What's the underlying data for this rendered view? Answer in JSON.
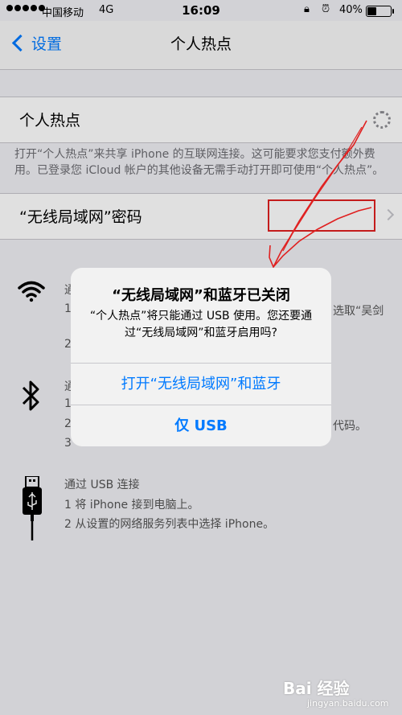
{
  "status_bar": {
    "carrier": "中国移动",
    "network": "4G",
    "time": "16:09",
    "battery_percent": "40%",
    "battery_level": 0.4
  },
  "nav": {
    "back_label": "设置",
    "title": "个人热点"
  },
  "hotspot_row": {
    "label": "个人热点"
  },
  "footnote": "打开“个人热点”来共享 iPhone 的互联网连接。这可能要求您支付额外费用。已登录您 iCloud 帐户的其他设备无需手动打开即可使用“个人热点”。",
  "password_row": {
    "label": "“无线局域网”密码"
  },
  "wifi_section": {
    "heading": "通",
    "line1": "1",
    "line1_tail": "选取“吴剑",
    "line2": "2"
  },
  "bt_section": {
    "heading": "通",
    "line1": "1",
    "line2": "2",
    "line2_tail": "代码。",
    "line3": "3"
  },
  "usb_section": {
    "heading": "通过 USB 连接",
    "step1": "1 将 iPhone 接到电脑上。",
    "step2": "2 从设置的网络服务列表中选择 iPhone。"
  },
  "alert": {
    "title": "“无线局域网”和蓝牙已关闭",
    "message": "“个人热点”将只能通过 USB 使用。您还要通过“无线局域网”和蓝牙启用吗?",
    "button_primary": "打开“无线局域网”和蓝牙",
    "button_usb": "仅 USB"
  },
  "watermark": {
    "brand": "Bai 经验",
    "url": "jingyan.baidu.com"
  },
  "colors": {
    "accent": "#007aff",
    "annotation": "#e02020",
    "background": "#efeff4"
  }
}
